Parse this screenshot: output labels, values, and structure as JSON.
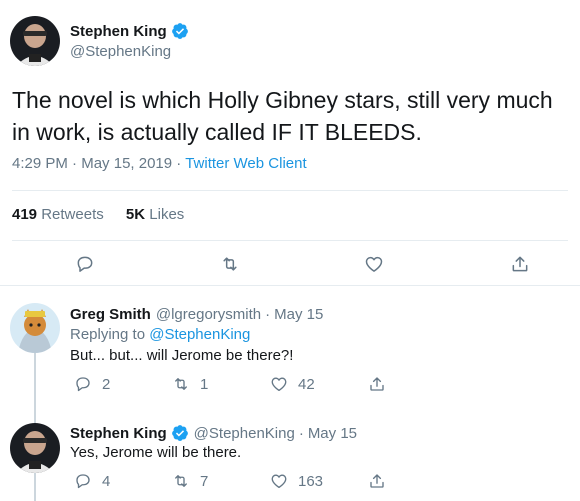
{
  "main_tweet": {
    "author_name": "Stephen King",
    "author_handle": "@StephenKing",
    "text": "The novel is which Holly Gibney stars, still very much in work, is actually called IF IT BLEEDS.",
    "time": "4:29 PM",
    "date": "May 15, 2019",
    "separator": "·",
    "client": "Twitter Web Client",
    "retweets_count": "419",
    "retweets_label": "Retweets",
    "likes_count": "5K",
    "likes_label": "Likes",
    "icons": [
      "reply-icon",
      "retweet-icon",
      "like-icon",
      "share-icon"
    ]
  },
  "replies": [
    {
      "author_name": "Greg Smith",
      "author_handle": "@lgregorysmith",
      "separator": "·",
      "date": "May 15",
      "replying_prefix": "Replying to",
      "replying_mention": "@StephenKing",
      "text": "But... but... will Jerome be there?!",
      "reply_count": "2",
      "retweet_count": "1",
      "like_count": "42"
    },
    {
      "author_name": "Stephen King",
      "author_handle": "@StephenKing",
      "separator": "·",
      "date": "May 15",
      "text": "Yes, Jerome will be there.",
      "reply_count": "4",
      "retweet_count": "7",
      "like_count": "163"
    }
  ],
  "colors": {
    "link": "#1b95e0",
    "verified": "#1da1f2",
    "muted": "#657786",
    "text": "#14171a",
    "border": "#e6ecf0"
  }
}
